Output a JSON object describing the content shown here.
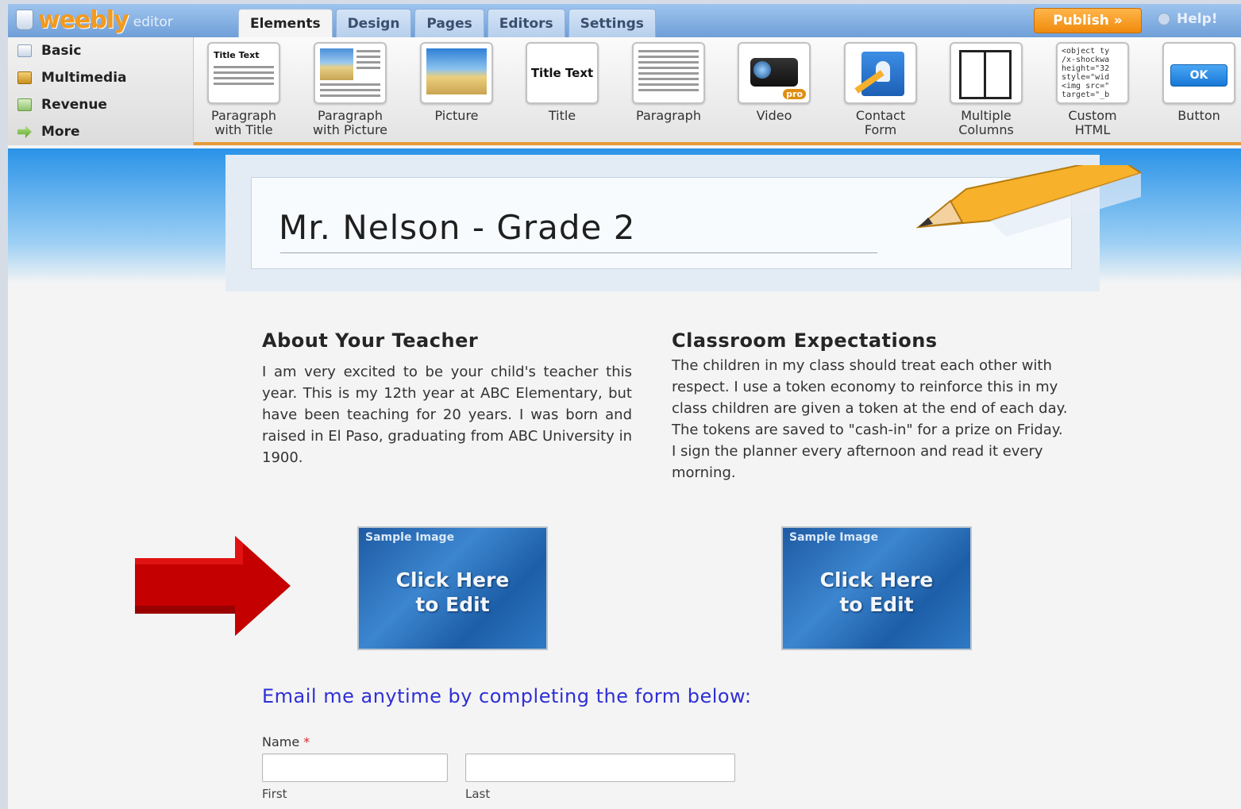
{
  "app": {
    "logo_word": "weebly",
    "logo_sub": "editor",
    "tabs": [
      {
        "label": "Elements",
        "active": true
      },
      {
        "label": "Design"
      },
      {
        "label": "Pages"
      },
      {
        "label": "Editors"
      },
      {
        "label": "Settings"
      }
    ],
    "publish_label": "Publish »",
    "help_label": "Help!"
  },
  "sidebar": {
    "items": [
      {
        "label": "Basic",
        "icon": "document-icon"
      },
      {
        "label": "Multimedia",
        "icon": "film-icon"
      },
      {
        "label": "Revenue",
        "icon": "money-icon"
      },
      {
        "label": "More",
        "icon": "arrow-right-icon"
      }
    ]
  },
  "elements": {
    "items": [
      {
        "label_1": "Paragraph",
        "label_2": "with Title",
        "thumb_text": "Title Text"
      },
      {
        "label_1": "Paragraph",
        "label_2": "with Picture"
      },
      {
        "label_1": "Picture",
        "label_2": ""
      },
      {
        "label_1": "Title",
        "label_2": "",
        "thumb_text": "Title Text"
      },
      {
        "label_1": "Paragraph",
        "label_2": ""
      },
      {
        "label_1": "Video",
        "label_2": "",
        "thumb_text": "pro"
      },
      {
        "label_1": "Contact",
        "label_2": "Form"
      },
      {
        "label_1": "Multiple",
        "label_2": "Columns"
      },
      {
        "label_1": "Custom",
        "label_2": "HTML",
        "thumb_text": "<object ty\n/x-shockwa\nheight=\"32\nstyle=\"wid\n<img src=\"\ntarget=\"_b"
      },
      {
        "label_1": "Button",
        "label_2": "",
        "thumb_text": "OK"
      }
    ]
  },
  "page": {
    "site_title": "Mr. Nelson - Grade 2",
    "about_title": "About Your Teacher",
    "about_text": "I am very excited to be your child's teacher this year. This is my 12th year at ABC Elementary, but have been teaching for 20 years. I was born and raised in El Paso, graduating from ABC University in 1900.",
    "expect_title": "Classroom Expectations",
    "expect_text": "The children in my class should treat each other with respect. I use a token economy to reinforce this in my class children are given a token at the end of each day. The tokens are saved to \"cash-in\" for a prize on Friday. I sign the planner every afternoon and read it every morning.",
    "sample_tag": "Sample Image",
    "sample_cta_1": "Click Here",
    "sample_cta_2": "to Edit",
    "email_title": "Email me anytime by completing the form below:",
    "name_label": "Name",
    "required_mark": "*",
    "first_label": "First",
    "last_label": "Last"
  },
  "colors": {
    "accent_orange": "#f08a0c",
    "link_blue": "#2f2fd6",
    "arrow_red": "#cc0000"
  }
}
